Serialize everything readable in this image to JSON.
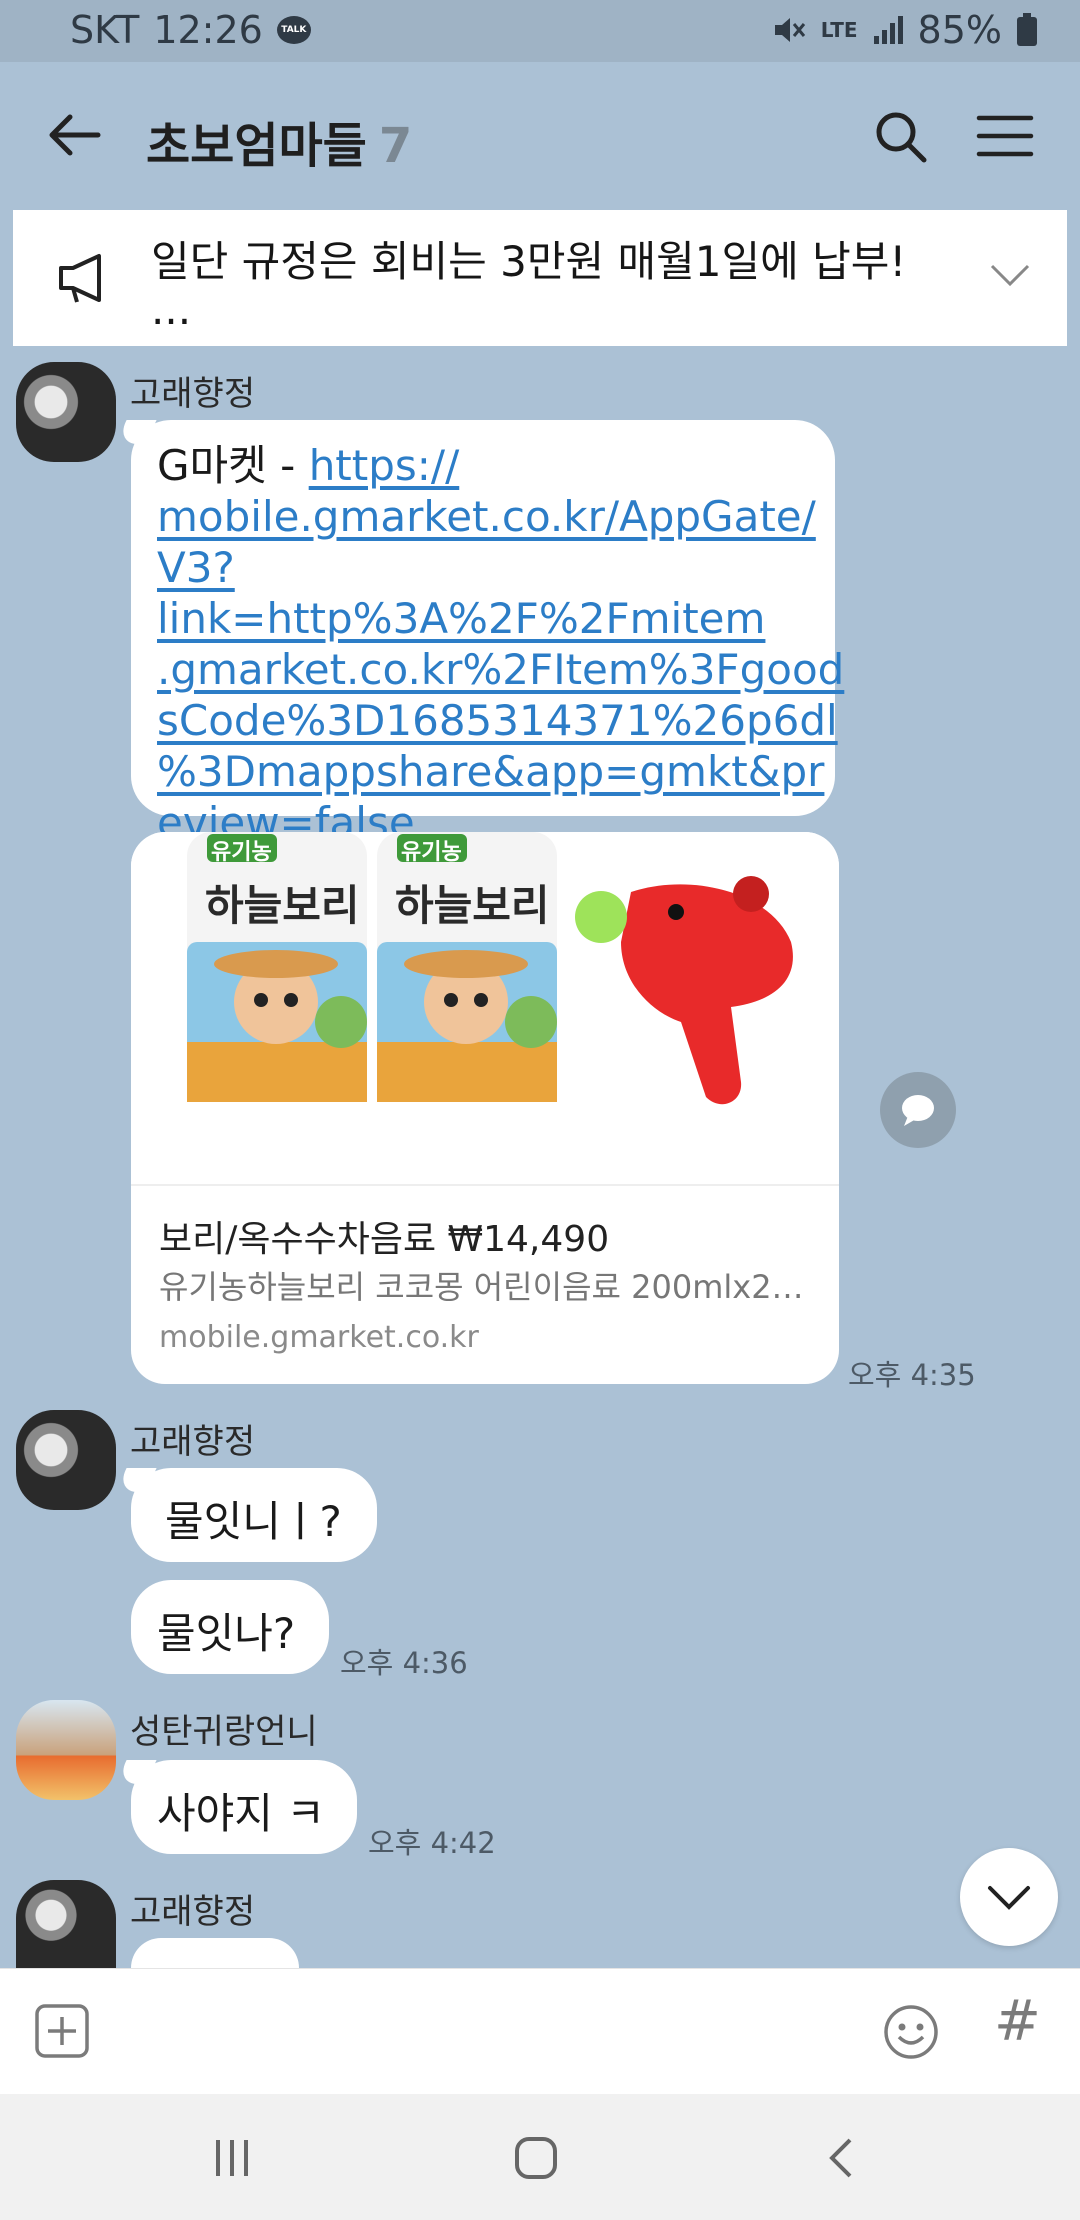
{
  "status_bar": {
    "carrier": "SKT",
    "time": "12:26",
    "talk_badge": "TALK",
    "network": "LTE",
    "battery": "85%"
  },
  "header": {
    "back_icon": "arrow-left-icon",
    "title": "초보엄마들",
    "member_count": "7",
    "search_icon": "search-icon",
    "menu_icon": "hamburger-menu-icon"
  },
  "notice": {
    "icon": "megaphone-icon",
    "text": "일단 규정은 회비는 3만원 매월1일에 납부!",
    "more": "...",
    "expand_icon": "chevron-down-icon"
  },
  "messages": {
    "m1": {
      "sender": "고래향정",
      "prefix": "G마켓 - ",
      "link_lines": [
        "https://",
        "mobile.gmarket.co.kr/AppGate/",
        "V3?link=http%3A%2F%2Fmitem",
        ".gmarket.co.kr%2FItem%3Fgood",
        "sCode%3D1685314371%26p6dl",
        "%3Dmappshare&app=gmkt&pr",
        "eview=false"
      ],
      "card": {
        "title": "보리/옥수수차음료 ₩14,490",
        "description": "유기농하늘보리 코코몽 어린이음료 200mlx2…",
        "domain": "mobile.gmarket.co.kr",
        "product_label": "하늘보리",
        "product_badge": "유기농"
      },
      "time": "오후 4:35"
    },
    "m2": {
      "sender": "고래향정",
      "text1": "물잇니ㅣ?",
      "text2": "물잇나?",
      "time": "오후 4:36"
    },
    "m3": {
      "sender": "성탄귀랑언니",
      "text": "사야지 ㅋ",
      "time": "오후 4:42"
    },
    "m4": {
      "sender": "고래향정"
    }
  },
  "input_bar": {
    "add_icon": "plus-square-icon",
    "emoji_icon": "smiley-icon",
    "hash_icon": "hashtag-icon",
    "hash_label": "#"
  },
  "colors": {
    "background": "#abc1d5",
    "link": "#2c7dc7",
    "bubble": "#ffffff"
  }
}
